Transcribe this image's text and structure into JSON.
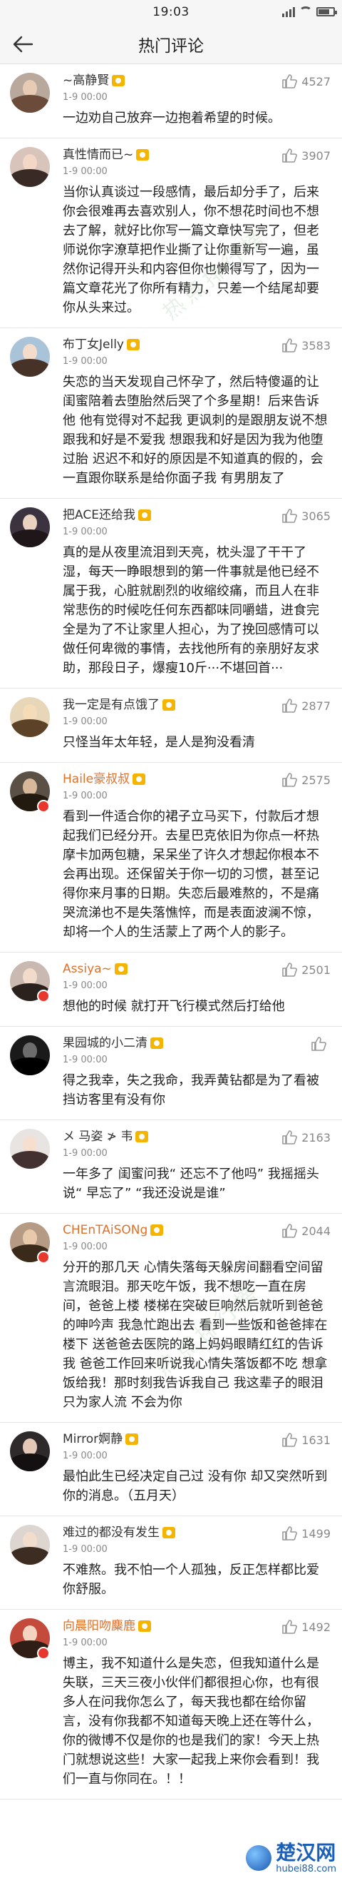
{
  "status_bar": {
    "time": "19:03"
  },
  "header": {
    "title": "热门评论"
  },
  "comments": [
    {
      "name": "~高静賢",
      "vip": false,
      "time": "1-9 00:00",
      "likes": "4527",
      "text": "一边劝自己放弃一边抱着希望的时候。",
      "avatar": {
        "bg": "#b9a89c",
        "face": "#e7cbb4",
        "cap": "#6b4b3a"
      }
    },
    {
      "name": "真性情而已~",
      "vip": false,
      "time": "1-9 00:00",
      "likes": "3907",
      "text": "当你认真谈过一段感情，最后却分手了，后来你会很难再去喜欢别人，你不想花时间也不想去了解，就好比你写一篇文章快写完了，但老师说你字潦草把作业撕了让你重新写一遍，虽然你记得开头和内容但你也懒得写了，因为一篇文章花光了你所有精力，只差一个结尾却要你从头来过。",
      "avatar": {
        "bg": "#d9c4bb",
        "face": "#f2d6c6",
        "cap": "#3a2a26"
      }
    },
    {
      "name": "布丁女Jelly",
      "vip": false,
      "time": "1-9 00:00",
      "likes": "3583",
      "text": "失恋的当天发现自己怀孕了，然后特傻逼的让闺蜜陪着去堕胎然后哭了个多星期！后来告诉他 他有觉得对不起我 更讽刺的是跟朋友说不想跟我和好是不爱我 想跟我和好是因为我为他堕过胎 迟迟不和好的原因是不知道真的假的，会一直跟你联系是给你面子我 有男朋友了",
      "avatar": {
        "bg": "#a9c3d9",
        "face": "#f4dccb",
        "cap": "#463226"
      }
    },
    {
      "name": "把ACE还给我",
      "vip": false,
      "time": "1-9 00:00",
      "likes": "3065",
      "text": "真的是从夜里流泪到天亮，枕头湿了干干了湿，每天一睁眼想到的第一件事就是他已经不属于我，心脏就剧烈的收缩绞痛，而且人在非常悲伤的时候吃任何东西都味同嚼蜡，进食完全是为了不让家里人担心，为了挽回感情可以做任何卑微的事情，去找他所有的亲朋好友求助，那段日子，爆瘦10斤···不堪回首···",
      "avatar": {
        "bg": "#3c3340",
        "face": "#ead2c0",
        "cap": "#1e1618"
      }
    },
    {
      "name": "我一定是有点饿了",
      "vip": false,
      "time": "1-9 00:00",
      "likes": "2877",
      "text": "只怪当年太年轻，是人是狗没看清",
      "avatar": {
        "bg": "#e7d7b8",
        "face": "#f4dcb8",
        "cap": "#5c4226"
      }
    },
    {
      "name": "Haile豪叔叔",
      "vip": true,
      "time": "1-9 00:00",
      "likes": "2575",
      "text": "看到一件适合你的裙子立马买下，付款后才想起我们已经分开。去星巴克依旧为你点一杯热摩卡加两包糖，呆呆坐了许久才想起你根本不会再出现。还保留关于你一切的习惯，甚至记得你来月事的日期。失恋后最难熬的，不是痛哭流涕也不是失落憔悴，而是表面波澜不惊，却将一个人的生活蒙上了两个人的影子。",
      "avatar": {
        "bg": "#5b5045",
        "face": "#d8b89a",
        "cap": "#22190f"
      }
    },
    {
      "name": "Assiya~",
      "vip": true,
      "time": "1-9 00:00",
      "likes": "2501",
      "text": "想他的时候 就打开飞行模式然后打给他",
      "avatar": {
        "bg": "#c9b9b0",
        "face": "#f3dbcb",
        "cap": "#2b211d"
      }
    },
    {
      "name": "果园城的小二清",
      "vip": false,
      "time": "1-9 00:00",
      "likes": "",
      "text": "得之我幸，失之我命，我弄黄钻都是为了看被挡访客里有没有你",
      "avatar": {
        "bg": "#1a1a1a",
        "face": "#6d6d6d",
        "cap": "#000000"
      }
    },
    {
      "name": "メ 马姿 ≯ 韦",
      "vip": false,
      "time": "1-9 00:00",
      "likes": "2163",
      "text": "一年多了 闺蜜问我“ 还忘不了他吗” 我摇摇头说“ 早忘了” “我还没说是谁”",
      "avatar": {
        "bg": "#e8e4e2",
        "face": "#f6dfcf",
        "cap": "#433030"
      }
    },
    {
      "name": "CHEnTAiSONg",
      "vip": true,
      "time": "1-9 00:00",
      "likes": "2044",
      "text": "分开的那几天 心情失落每天躲房间翻看空间留言流眼泪。那天吃午饭，我不想吃一直在房间，爸爸上楼 楼梯在突破巨响然后就听到爸爸的呻吟声 我急忙跑出去 看到一些饭和爸爸摔在楼下 送爸爸去医院的路上妈妈眼睛红红的告诉我 爸爸工作回来听说我心情失落饭都不吃 想拿饭给我！那时刻我告诉我自己 我这辈子的眼泪只为家人流 不会为你",
      "avatar": {
        "bg": "#b59a84",
        "face": "#e8c9aa",
        "cap": "#3a2a1a"
      }
    },
    {
      "name": "Mirror婀静",
      "vip": false,
      "time": "1-9 00:00",
      "likes": "1631",
      "text": "最怕此生已经决定自己过 没有你 却又突然听到你的消息。（五月天）",
      "avatar": {
        "bg": "#2e2a2c",
        "face": "#e3c8b8",
        "cap": "#141012"
      }
    },
    {
      "name": "难过的都没有发生",
      "vip": false,
      "time": "1-9 00:00",
      "likes": "1499",
      "text": "不难熬。我不怕一个人孤独，反正怎样都比爱你舒服。",
      "avatar": {
        "bg": "#ddd5cf",
        "face": "#f2dccc",
        "cap": "#3c2c22"
      }
    },
    {
      "name": "向晨阳吻麋鹿",
      "vip": true,
      "time": "1-9 00:00",
      "likes": "1492",
      "text": "博主，我不知道什么是失恋，但我知道什么是失联，三天三夜小伙伴们都很担心你，也有很多人在问我你怎么了，每天我也都在给你留言，没有你我都不知道每天晚上还在等什么，你的微博不仅是你的也是我们的家！今天上热门就想说这些！大家一起我上来你会看到！我们一直与你同在。！！",
      "avatar": {
        "bg": "#c44a3c",
        "face": "#f3d4c0",
        "cap": "#2f1d16"
      }
    }
  ],
  "watermark_text": "热点排行榜",
  "footer": {
    "brand": "楚汉网",
    "site": "hubei88.com"
  }
}
